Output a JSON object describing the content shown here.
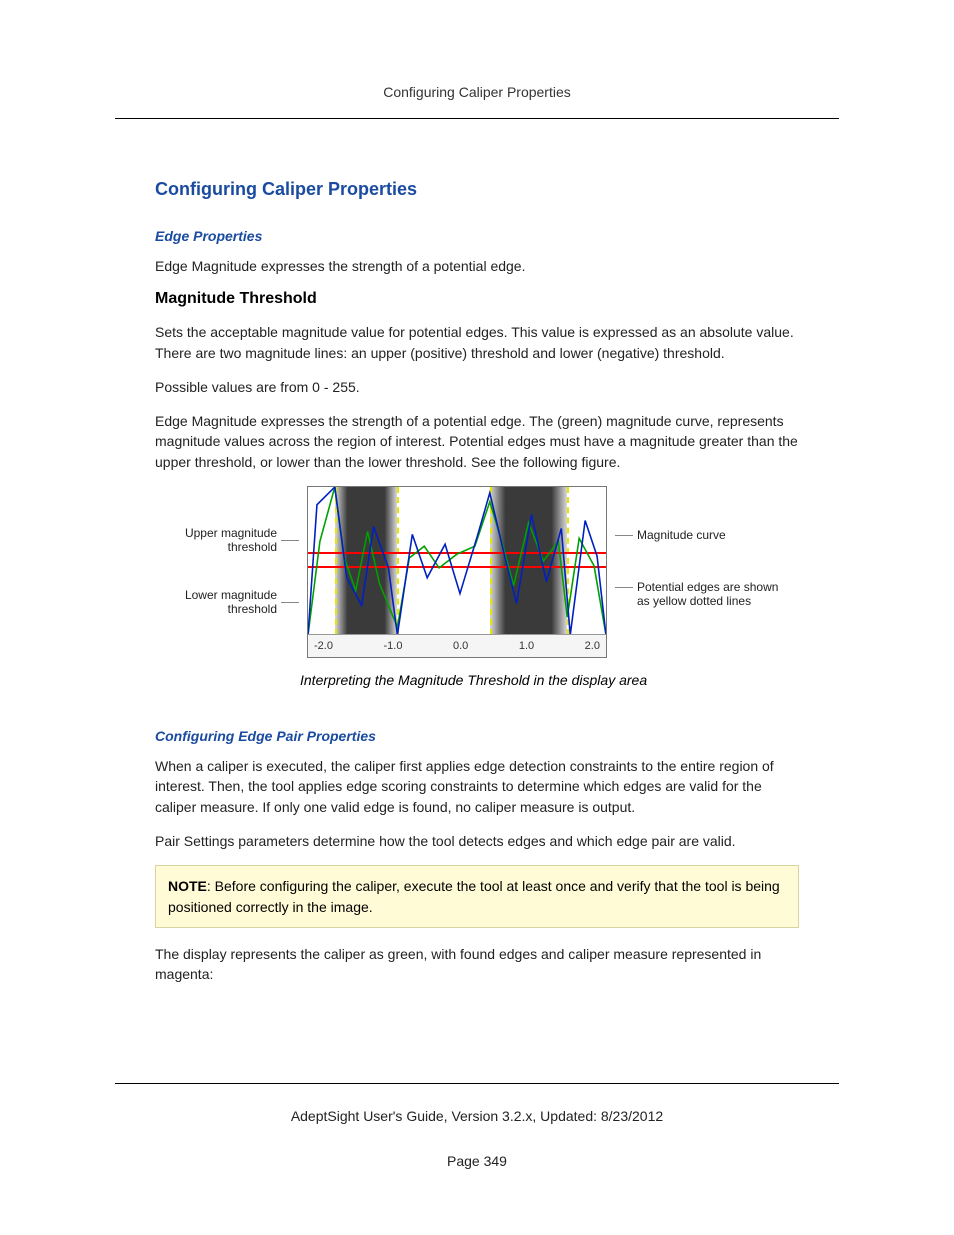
{
  "header_running": "Configuring Caliper Properties",
  "title": "Configuring Caliper Properties",
  "section_edge": "Edge Properties",
  "p_edge_intro": "Edge Magnitude expresses the strength of a potential edge.",
  "h_magnitude": "Magnitude Threshold",
  "p_mag1": "Sets the acceptable magnitude value for potential edges. This value is expressed as an absolute value. There are two magnitude lines: an upper (positive) threshold and lower (negative) threshold.",
  "p_mag2": "Possible values are from 0 - 255.",
  "p_mag3": "Edge Magnitude expresses the strength of a potential edge. The (green) magnitude curve, represents magnitude values across the region of interest. Potential edges must have a magnitude greater than the upper threshold, or lower than the lower threshold. See the following figure.",
  "figure": {
    "left_label_upper": "Upper magnitude threshold",
    "left_label_lower": "Lower magnitude threshold",
    "right_label_curve": "Magnitude curve",
    "right_label_edges": "Potential edges are shown as yellow dotted lines",
    "caption": "Interpreting the Magnitude Threshold in the display area",
    "ticks": [
      "-2.0",
      "-1.0",
      "0.0",
      "1.0",
      "2.0"
    ]
  },
  "section_pair": "Configuring Edge Pair Properties",
  "p_pair1": "When a caliper is executed, the caliper first applies edge detection constraints to the entire region of interest. Then, the tool applies edge scoring constraints to determine which edges are valid for the caliper measure. If only one valid edge is found, no caliper measure is output.",
  "p_pair2": "Pair Settings parameters determine how the tool detects edges and which edge pair are valid.",
  "note_label": "NOTE",
  "note_body": ": Before configuring the caliper, execute the tool at least once and verify that the tool is being positioned correctly in the image.",
  "p_pair3": "The display represents the caliper as green, with found edges and caliper measure represented in magenta:",
  "footer_guide": "AdeptSight User's Guide,  Version 3.2.x, Updated: 8/23/2012",
  "footer_page": "Page 349",
  "chart_data": {
    "type": "line",
    "xlim": [
      -2.5,
      2.5
    ],
    "x_ticks": [
      -2.0,
      -1.0,
      0.0,
      1.0,
      2.0
    ],
    "upper_threshold_y": 66,
    "lower_threshold_y": 80,
    "dark_bands_x": [
      [
        -2.05,
        -1.0
      ],
      [
        0.55,
        1.85
      ]
    ],
    "potential_edges_x": [
      -2.05,
      -1.0,
      0.55,
      1.85
    ],
    "series": [
      {
        "name": "magnitude_curve_green",
        "color": "#00a000",
        "points": [
          [
            -2.5,
            150
          ],
          [
            -2.3,
            55
          ],
          [
            -2.05,
            -8
          ],
          [
            -1.9,
            70
          ],
          [
            -1.7,
            105
          ],
          [
            -1.5,
            45
          ],
          [
            -1.3,
            98
          ],
          [
            -1.0,
            142
          ],
          [
            -0.8,
            72
          ],
          [
            -0.55,
            60
          ],
          [
            -0.3,
            82
          ],
          [
            0.0,
            68
          ],
          [
            0.3,
            60
          ],
          [
            0.55,
            15
          ],
          [
            0.75,
            55
          ],
          [
            0.95,
            100
          ],
          [
            1.2,
            36
          ],
          [
            1.45,
            75
          ],
          [
            1.7,
            55
          ],
          [
            1.85,
            132
          ],
          [
            2.05,
            52
          ],
          [
            2.3,
            80
          ],
          [
            2.5,
            150
          ]
        ]
      },
      {
        "name": "blue_curve",
        "color": "#0020c0",
        "points": [
          [
            -2.5,
            150
          ],
          [
            -2.35,
            18
          ],
          [
            -2.05,
            -5
          ],
          [
            -1.85,
            92
          ],
          [
            -1.6,
            120
          ],
          [
            -1.4,
            40
          ],
          [
            -1.15,
            82
          ],
          [
            -1.0,
            150
          ],
          [
            -0.75,
            48
          ],
          [
            -0.5,
            92
          ],
          [
            -0.2,
            58
          ],
          [
            0.05,
            108
          ],
          [
            0.35,
            48
          ],
          [
            0.55,
            6
          ],
          [
            0.8,
            70
          ],
          [
            1.0,
            118
          ],
          [
            1.25,
            28
          ],
          [
            1.5,
            96
          ],
          [
            1.75,
            42
          ],
          [
            1.9,
            150
          ],
          [
            2.15,
            34
          ],
          [
            2.35,
            70
          ],
          [
            2.5,
            150
          ]
        ]
      }
    ],
    "title": "",
    "xlabel": "",
    "ylabel": ""
  }
}
